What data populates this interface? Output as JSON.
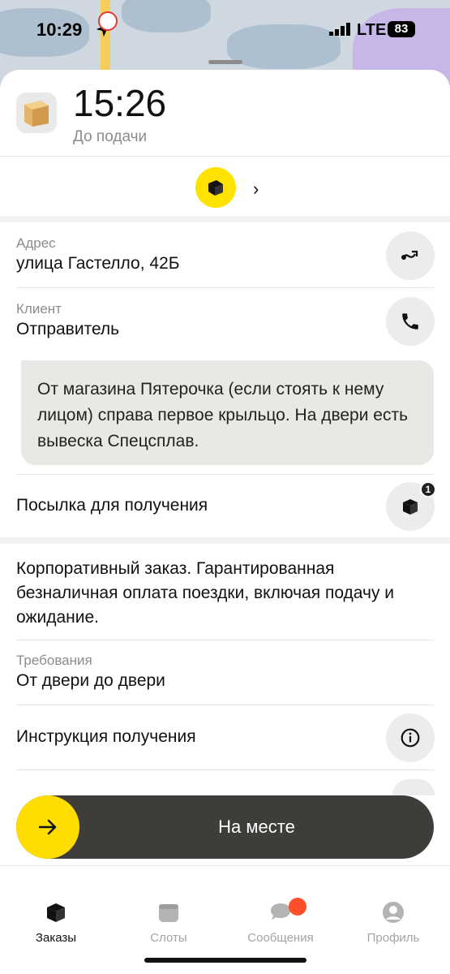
{
  "status_bar": {
    "time": "10:29",
    "network": "LTE",
    "battery": "83"
  },
  "header": {
    "time": "15:26",
    "subtitle": "До подачи"
  },
  "address": {
    "label": "Адрес",
    "value": "улица Гастелло, 42Б"
  },
  "client": {
    "label": "Клиент",
    "value": "Отправитель"
  },
  "comment": "От магазина Пятерочка (если стоять к нему лицом) справа первое крыльцо. На двери есть вывеска Спецсплав.",
  "parcel": {
    "label": "Посылка для получения",
    "count": "1"
  },
  "payment_note": "Корпоративный заказ. Гарантированная безналичная оплата поездки, включая подачу и ожидание.",
  "requirements": {
    "label": "Требования",
    "value": "От двери до двери"
  },
  "instruction": {
    "label": "Инструкция получения"
  },
  "action_button": {
    "label": "На месте"
  },
  "tabs": [
    {
      "label": "Заказы",
      "icon": "box-icon",
      "active": true
    },
    {
      "label": "Слоты",
      "icon": "calendar-icon",
      "active": false
    },
    {
      "label": "Сообщения",
      "icon": "chat-icon",
      "active": false
    },
    {
      "label": "Профиль",
      "icon": "profile-icon",
      "active": false
    }
  ],
  "colors": {
    "accent_yellow": "#ffdd00",
    "action_dark": "#3f3d3a",
    "notification_red": "#ff4e2a"
  }
}
